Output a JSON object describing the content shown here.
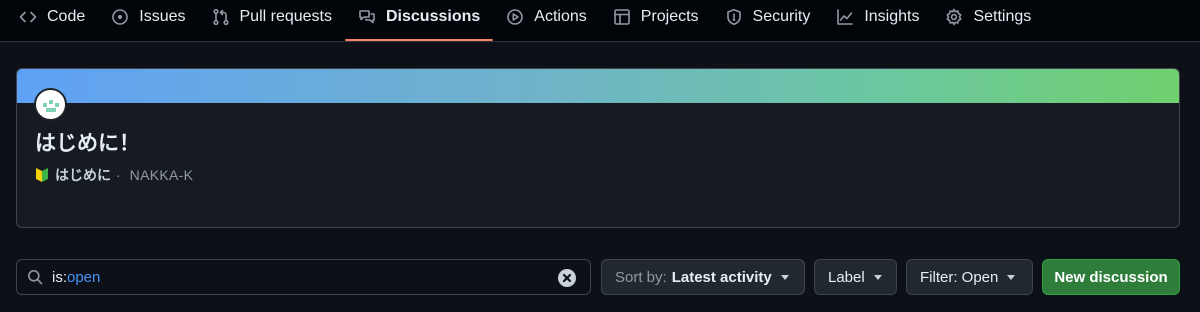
{
  "nav": {
    "tabs": [
      {
        "label": "Code",
        "icon": "code-icon",
        "active": false
      },
      {
        "label": "Issues",
        "icon": "issue-opened-icon",
        "active": false
      },
      {
        "label": "Pull requests",
        "icon": "git-pull-request-icon",
        "active": false
      },
      {
        "label": "Discussions",
        "icon": "comment-discussion-icon",
        "active": true
      },
      {
        "label": "Actions",
        "icon": "play-icon",
        "active": false
      },
      {
        "label": "Projects",
        "icon": "table-icon",
        "active": false
      },
      {
        "label": "Security",
        "icon": "shield-icon",
        "active": false
      },
      {
        "label": "Insights",
        "icon": "graph-icon",
        "active": false
      },
      {
        "label": "Settings",
        "icon": "gear-icon",
        "active": false
      }
    ],
    "active_underline_color": "#f78166"
  },
  "pinned": {
    "title": "はじめに！",
    "category": "はじめに",
    "category_icon": "beginner-icon",
    "separator": "·",
    "author": "NAKKA-K",
    "gradient_colors": [
      "#5fa1f5",
      "#71d06e"
    ]
  },
  "search": {
    "qualifier": "is:",
    "value": "open",
    "icon": "search-icon",
    "clear_icon": "x-circle-fill-icon"
  },
  "toolbar": {
    "sort_prefix": "Sort by:",
    "sort_value": "Latest activity",
    "label_button": "Label",
    "filter_button": "Filter: Open",
    "new_discussion_button": "New discussion",
    "primary_color": "#2f7d3b"
  }
}
